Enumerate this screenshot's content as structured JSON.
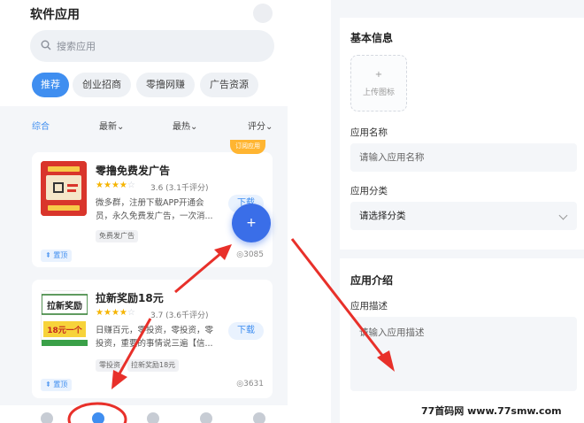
{
  "left": {
    "title": "软件应用",
    "search": {
      "placeholder": "搜索应用"
    },
    "chips": [
      {
        "label": "推荐",
        "active": true
      },
      {
        "label": "创业招商",
        "active": false
      },
      {
        "label": "零撸网赚",
        "active": false
      },
      {
        "label": "广告资源",
        "active": false
      }
    ],
    "sorts": [
      {
        "label": "综合",
        "active": true
      },
      {
        "label": "最新",
        "arrow": true
      },
      {
        "label": "最热",
        "arrow": true
      },
      {
        "label": "评分",
        "arrow": true
      }
    ],
    "cards": [
      {
        "ribbon": "订阅应用",
        "title": "零撸免费发广告",
        "stars_filled": 4,
        "stars_total": 5,
        "rating": "3.6 (3.1千评分)",
        "desc": "微多群，注册下载APP开通会员，永久免费发广告，一次消...",
        "button": "下载",
        "tags": [
          "免费发广告"
        ],
        "badge": "置顶",
        "views": "3085"
      },
      {
        "title": "拉新奖励18元",
        "stars_filled": 4,
        "stars_total": 5,
        "rating": "3.7 (3.6千评分)",
        "desc": "日赚百元，零投资，零投资，零投资，重要的事情说三遍【信...",
        "button": "下载",
        "tags": [
          "零投资",
          "拉新奖励18元"
        ],
        "badge": "置顶",
        "views": "3631",
        "thumb_text_top": "拉新奖励",
        "thumb_text_bottom": "18元一个"
      }
    ],
    "fab": "+"
  },
  "right": {
    "basic_title": "基本信息",
    "upload_plus": "+",
    "upload_label": "上传图标",
    "name_label": "应用名称",
    "name_placeholder": "请输入应用名称",
    "category_label": "应用分类",
    "category_value": "请选择分类",
    "intro_title": "应用介绍",
    "desc_label": "应用描述",
    "desc_placeholder": "请输入应用描述"
  },
  "watermark": "77首码网 www.77smw.com",
  "colors": {
    "accent": "#3f8ef0",
    "arrow": "#e8302a",
    "star": "#f5b400"
  }
}
